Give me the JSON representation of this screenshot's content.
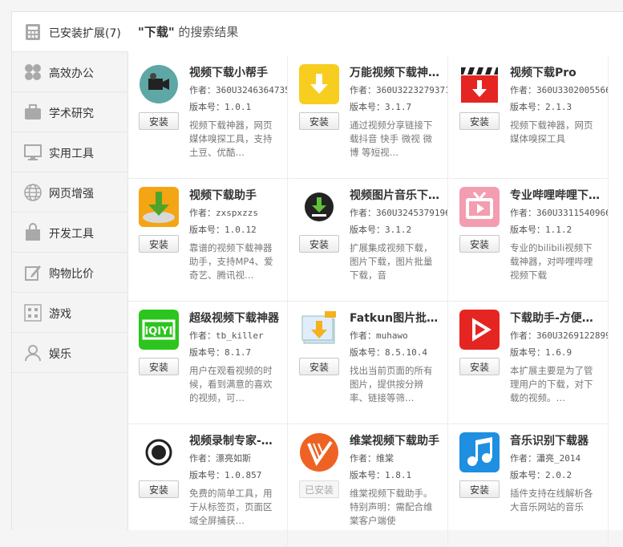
{
  "sidebar": {
    "items": [
      {
        "label": "已安装扩展(7)",
        "icon": "calculator-icon",
        "active": true
      },
      {
        "label": "高效办公",
        "icon": "clover-icon"
      },
      {
        "label": "学术研究",
        "icon": "briefcase-icon"
      },
      {
        "label": "实用工具",
        "icon": "monitor-icon"
      },
      {
        "label": "网页增强",
        "icon": "globe-icon"
      },
      {
        "label": "开发工具",
        "icon": "bag-icon"
      },
      {
        "label": "购物比价",
        "icon": "pencil-icon"
      },
      {
        "label": "游戏",
        "icon": "grid-icon"
      },
      {
        "label": "娱乐",
        "icon": "person-icon"
      }
    ]
  },
  "search": {
    "query": "\"下载\"",
    "suffix": " 的搜索结果"
  },
  "labels": {
    "author_prefix": "作者：",
    "version_prefix": "版本号："
  },
  "extensions": [
    {
      "name": "视频下载小帮手",
      "author": "360U3246364735",
      "version": "1.0.1",
      "desc": "视频下载神器，网页媒体嗅探工具，支持土豆、优酷…",
      "button": "安装",
      "disabled": false,
      "icon": "video-helper-icon"
    },
    {
      "name": "万能视频下载神…",
      "author": "360U3223279371",
      "version": "3.1.7",
      "desc": "通过视频分享链接下载抖音 快手 微视 微博 等短视…",
      "button": "安装",
      "disabled": false,
      "icon": "download-arrow-icon"
    },
    {
      "name": "视频下载Pro",
      "author": "360U3302005566",
      "version": "2.1.3",
      "desc": "视频下载神器，网页媒体嗅探工具",
      "button": "安装",
      "disabled": false,
      "icon": "clapperboard-icon"
    },
    {
      "name": "视频下载助手",
      "author": "zxspxzzs",
      "version": "1.0.12",
      "desc": "靠谱的视频下载神器助手，支持MP4、爱奇艺、腾讯视…",
      "button": "安装",
      "disabled": false,
      "icon": "download-disk-icon"
    },
    {
      "name": "视频图片音乐下…",
      "author": "360U3245379196",
      "version": "3.1.2",
      "desc": "扩展集成视频下载，图片下载，图片批量下载，音",
      "button": "安装",
      "disabled": false,
      "icon": "download-circle-icon"
    },
    {
      "name": "专业哔哩哔哩下…",
      "author": "360U3311540966",
      "version": "1.1.2",
      "desc": "专业的bilibili视频下载神器，对哔哩哔哩视频下载",
      "button": "安装",
      "disabled": false,
      "icon": "tv-icon"
    },
    {
      "name": "超级视频下载神器",
      "author": "tb_killer",
      "version": "8.1.7",
      "desc": "用户在观看视频的时候，看到满意的喜欢的视频，可…",
      "button": "安装",
      "disabled": false,
      "icon": "iqiyi-icon"
    },
    {
      "name": "Fatkun图片批…",
      "author": "muhawo",
      "version": "8.5.10.4",
      "desc": "找出当前页面的所有图片，提供按分辨率、链接等筛…",
      "button": "安装",
      "disabled": false,
      "icon": "image-download-icon"
    },
    {
      "name": "下载助手-方便…",
      "author": "360U3269122899",
      "version": "1.6.9",
      "desc": "本扩展主要是为了管理用户的下载，对下载的视频。…",
      "button": "安装",
      "disabled": false,
      "icon": "play-icon"
    },
    {
      "name": "视频录制专家-…",
      "author": "漂亮如斯",
      "version": "1.0.857",
      "desc": "免费的简单工具，用于从标签页，页面区域全屏捕获…",
      "button": "安装",
      "disabled": false,
      "icon": "record-icon"
    },
    {
      "name": "维棠视频下载助手",
      "author": "维棠",
      "version": "1.8.1",
      "desc": "维棠视频下载助手。特别声明：需配合维棠客户端使",
      "button": "已安装",
      "disabled": true,
      "icon": "weitang-icon"
    },
    {
      "name": "音乐识别下载器",
      "author": "瀟亮_2014",
      "version": "2.0.2",
      "desc": "插件支持在线解析各大音乐网站的音乐",
      "button": "安装",
      "disabled": false,
      "icon": "music-note-icon"
    }
  ]
}
